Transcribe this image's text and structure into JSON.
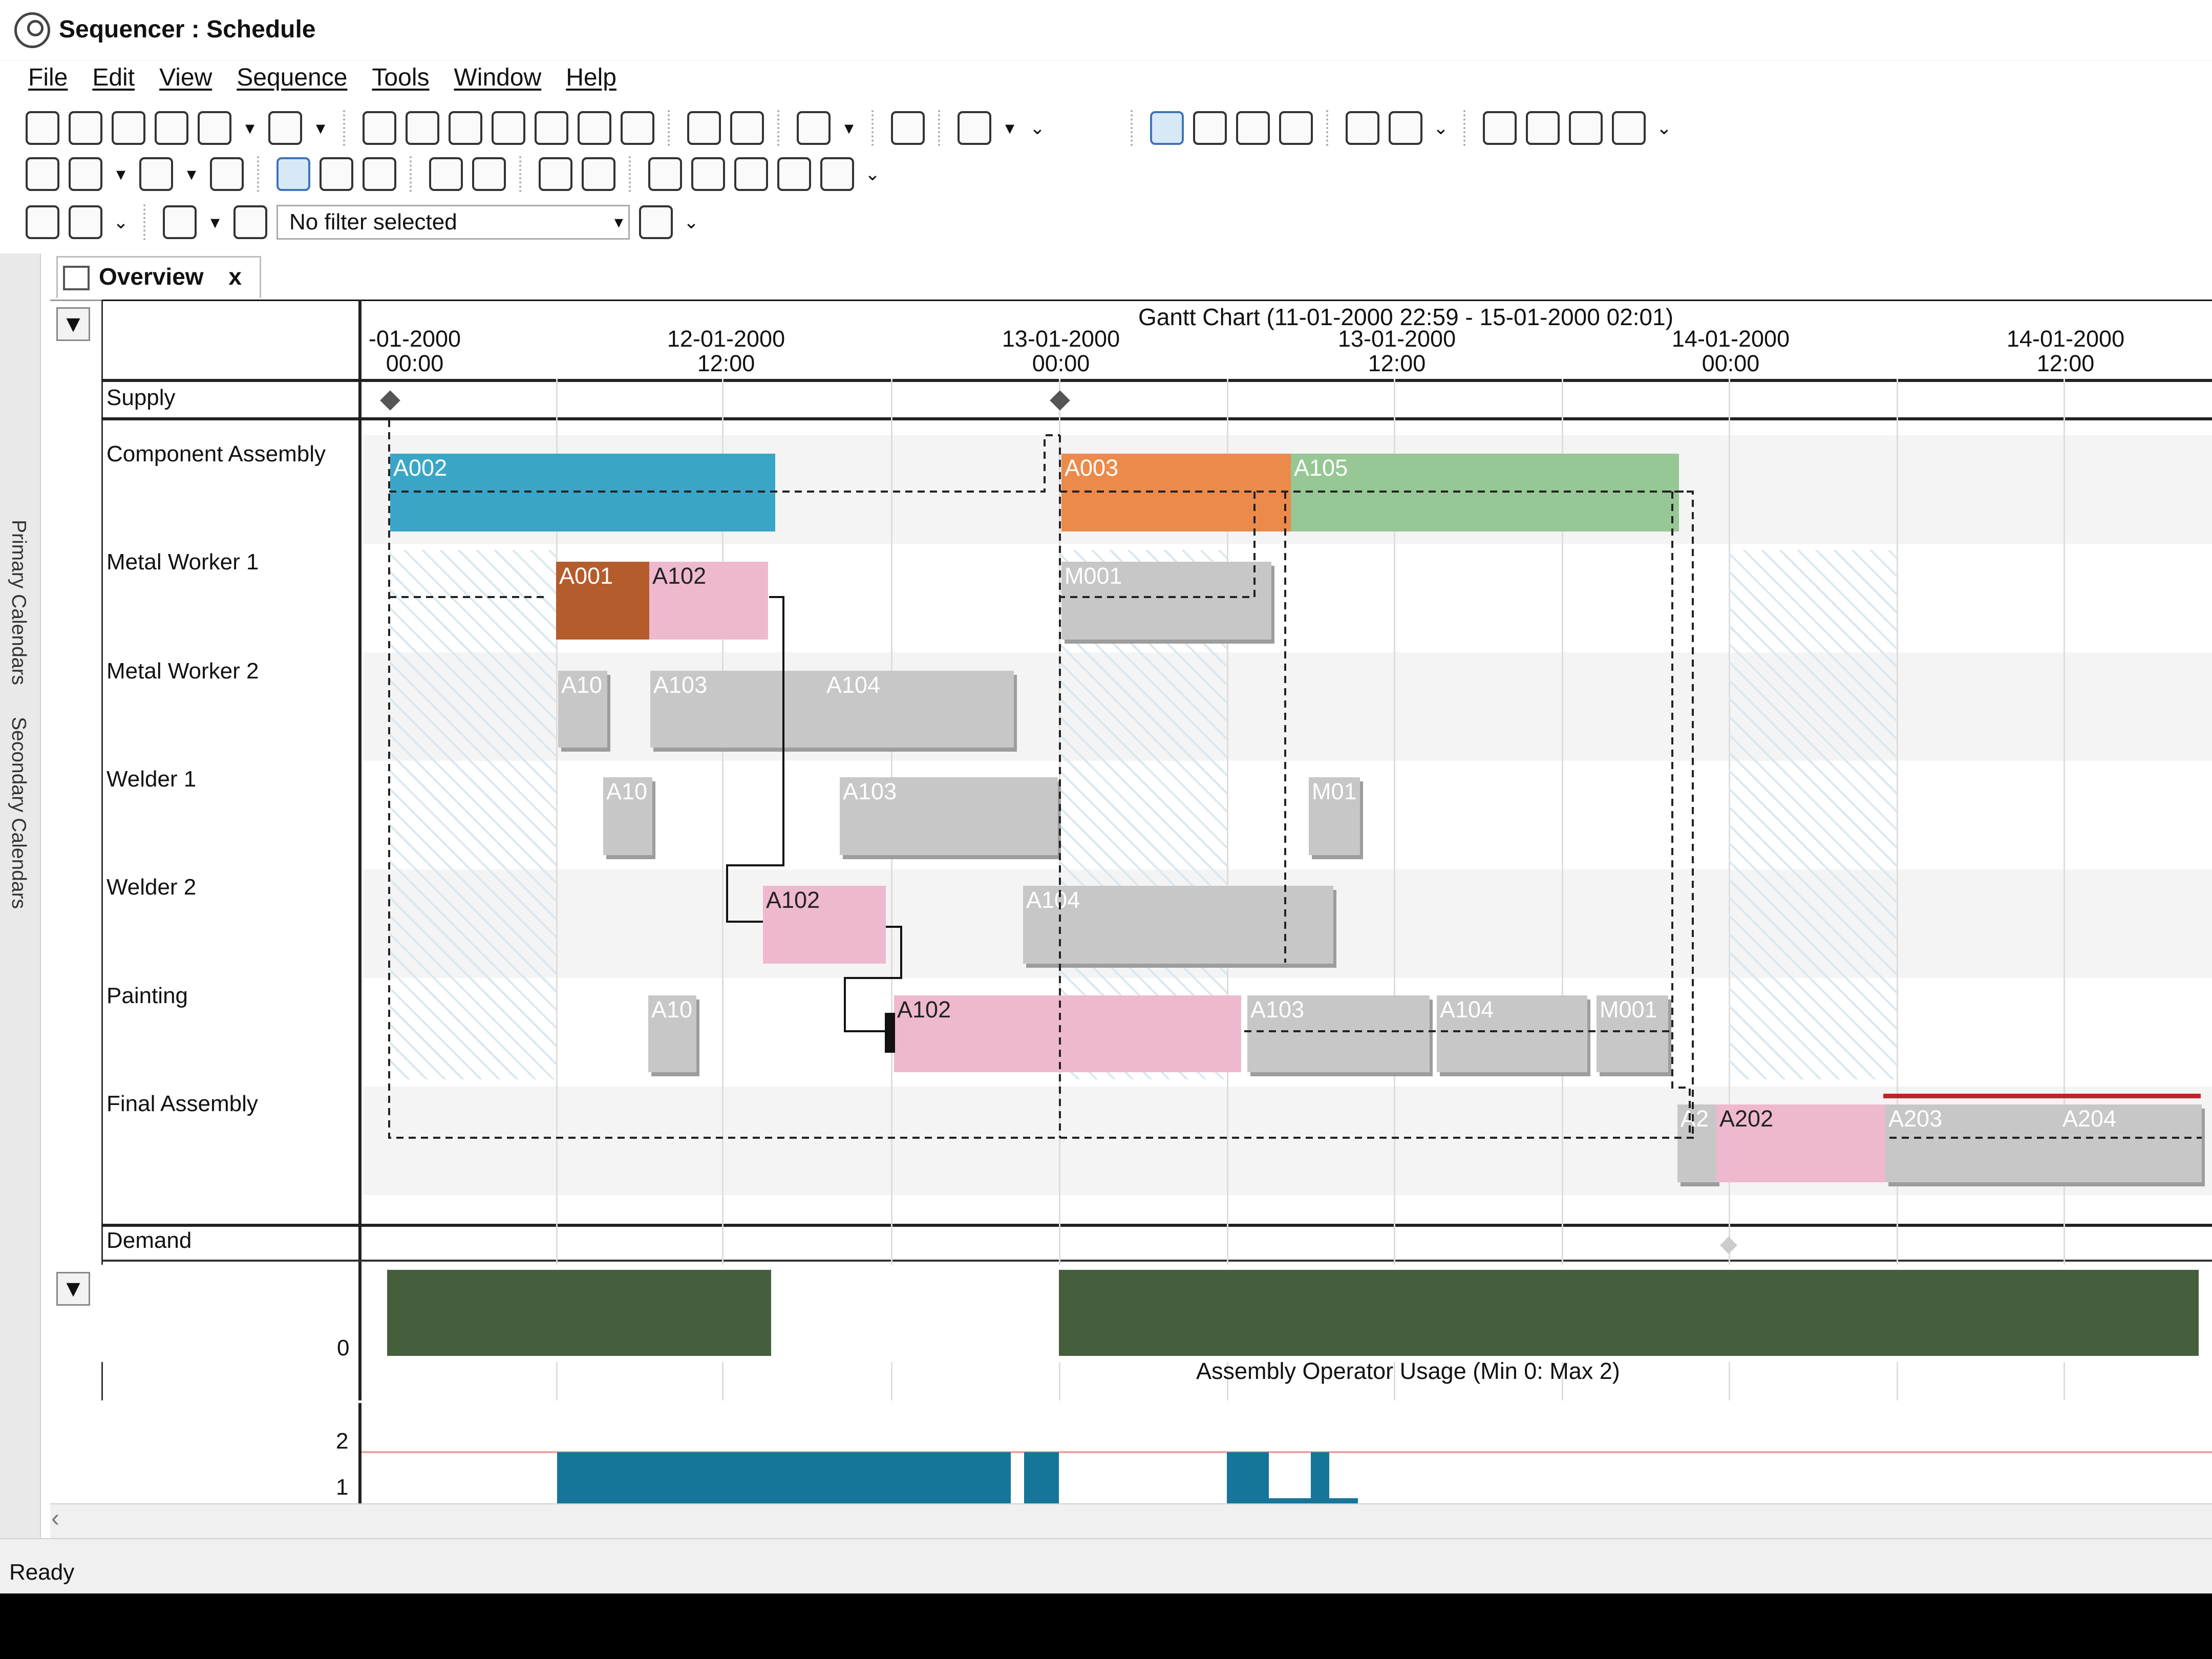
{
  "window": {
    "title": "Sequencer : Schedule",
    "icon": "sequencer-icon"
  },
  "menu": [
    {
      "label": "File"
    },
    {
      "label": "Edit"
    },
    {
      "label": "View"
    },
    {
      "label": "Sequence"
    },
    {
      "label": "Tools"
    },
    {
      "label": "Window"
    },
    {
      "label": "Help"
    }
  ],
  "toolbar": {
    "filter_placeholder": "No filter selected",
    "rows": [
      [
        "open-icon",
        "save-as-icon",
        "save-icon",
        "check-icon",
        "undo-icon",
        "redo-icon",
        "grid-icon",
        "grid-icon",
        "grid-icon",
        "chart-icon",
        "chart-icon",
        "chart-icon",
        "chart-icon",
        "link-icon",
        "link-icon",
        "edit-icon",
        "help-icon",
        "options-icon",
        "calendar-icon",
        "calendar-icon",
        "calendar-icon",
        "calendar-icon",
        "arrow-icon",
        "arrow-icon",
        "percent-icon",
        "percent-icon",
        "percent-icon",
        "percent-icon"
      ],
      [
        "filter-icon",
        "play-icon",
        "sort-icon",
        "swap-icon",
        "schedule-icon",
        "schedule-icon",
        "schedule-icon",
        "link-icon",
        "group-icon",
        "duplicate-icon",
        "infinity-icon",
        "check-icon",
        "report-icon",
        "globe-icon",
        "report-icon",
        "export-icon"
      ],
      [
        "table-icon",
        "table-icon",
        "filter-icon",
        "funnel-icon",
        "filter-settings-icon"
      ]
    ]
  },
  "left_tabs": [
    {
      "label": "Primary Calendars"
    },
    {
      "label": "Secondary Calendars"
    }
  ],
  "document_tab": {
    "label": "Overview",
    "close": "x",
    "icon": "calendar-icon"
  },
  "gantt": {
    "title": "Gantt Chart   (11-01-2000 22:59 - 15-01-2000 02:01)",
    "time_ticks": [
      {
        "date": "-01-2000",
        "time": "00:00"
      },
      {
        "date": "12-01-2000",
        "time": "12:00"
      },
      {
        "date": "13-01-2000",
        "time": "00:00"
      },
      {
        "date": "13-01-2000",
        "time": "12:00"
      },
      {
        "date": "14-01-2000",
        "time": "00:00"
      },
      {
        "date": "14-01-2000",
        "time": "12:00"
      }
    ],
    "rows": [
      {
        "name": "Supply"
      },
      {
        "name": "Component Assembly"
      },
      {
        "name": "Metal Worker 1"
      },
      {
        "name": "Metal Worker 2"
      },
      {
        "name": "Welder 1"
      },
      {
        "name": "Welder 2"
      },
      {
        "name": "Painting"
      },
      {
        "name": "Final Assembly"
      },
      {
        "name": "Demand"
      }
    ],
    "bars": [
      {
        "label": "A002",
        "color": "#3aa6c7"
      },
      {
        "label": "A003",
        "color": "#ec8a4b"
      },
      {
        "label": "A105",
        "color": "#96c794"
      },
      {
        "label": "A001",
        "color": "#b55c2d"
      },
      {
        "label": "A102",
        "color": "#eeb9cf"
      },
      {
        "label": "M001",
        "color": "#c7c7c7"
      },
      {
        "label": "A10",
        "color": "#c7c7c7"
      },
      {
        "label": "A103",
        "color": "#c7c7c7"
      },
      {
        "label": "A104",
        "color": "#c7c7c7"
      },
      {
        "label": "A10",
        "color": "#c7c7c7"
      },
      {
        "label": "A103",
        "color": "#c7c7c7"
      },
      {
        "label": "M01",
        "color": "#c7c7c7"
      },
      {
        "label": "A102",
        "color": "#eeb9cf"
      },
      {
        "label": "A104",
        "color": "#c7c7c7"
      },
      {
        "label": "A10",
        "color": "#c7c7c7"
      },
      {
        "label": "A102",
        "color": "#eeb9cf"
      },
      {
        "label": "A103",
        "color": "#c7c7c7"
      },
      {
        "label": "A104",
        "color": "#c7c7c7"
      },
      {
        "label": "M001",
        "color": "#c7c7c7"
      },
      {
        "label": "A2",
        "color": "#c7c7c7"
      },
      {
        "label": "A202",
        "color": "#eeb9cf"
      },
      {
        "label": "A203",
        "color": "#c7c7c7"
      },
      {
        "label": "A204",
        "color": "#c7c7c7"
      }
    ]
  },
  "usage_upper": {
    "label": "0",
    "color": "#455f3d"
  },
  "usage_lower": {
    "title": "Assembly Operator Usage (Min 0: Max 2)",
    "ticks": [
      "2",
      "1"
    ],
    "color": "#16759a"
  },
  "status": {
    "text": "Ready"
  }
}
